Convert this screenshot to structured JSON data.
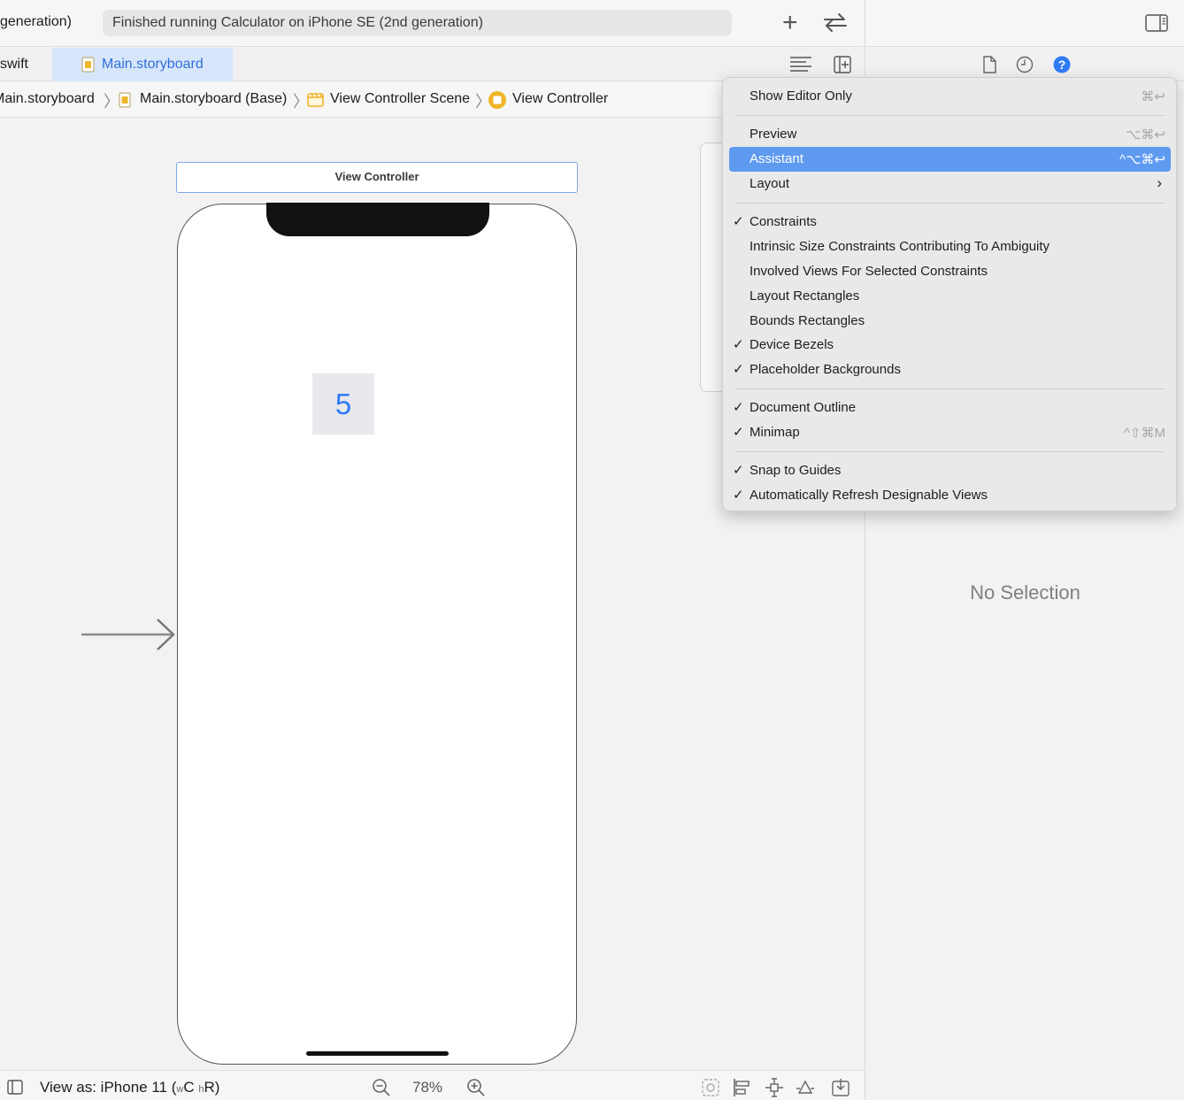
{
  "toolbar": {
    "scheme_text": "generation)",
    "activity_status": "Finished running Calculator on iPhone SE (2nd generation)"
  },
  "tabs": {
    "swift_tab": "swift",
    "storyboard_tab": "Main.storyboard"
  },
  "breadcrumb": {
    "items": [
      "Main.storyboard",
      "Main.storyboard (Base)",
      "View Controller Scene",
      "View Controller"
    ]
  },
  "canvas": {
    "scene_title": "View Controller",
    "result_label": "5"
  },
  "bottombar": {
    "view_as_prefix": "View as: iPhone 11 (",
    "w_small": "w",
    "w_value": "C ",
    "h_small": "h",
    "h_value": "R)",
    "zoom_level": "78%"
  },
  "inspector": {
    "empty_state": "No Selection"
  },
  "editor_menu": {
    "items": [
      {
        "label": "Show Editor Only",
        "shortcut": "⌘↩",
        "checked": false
      },
      {
        "label": "Preview",
        "shortcut": "⌥⌘↩",
        "checked": false
      },
      {
        "label": "Assistant",
        "shortcut": "^⌥⌘↩",
        "checked": false,
        "selected": true
      },
      {
        "label": "Layout",
        "shortcut": "",
        "checked": false,
        "submenu": true
      },
      {
        "label": "Constraints",
        "shortcut": "",
        "checked": true
      },
      {
        "label": "Intrinsic Size Constraints Contributing To Ambiguity",
        "shortcut": "",
        "checked": false
      },
      {
        "label": "Involved Views For Selected Constraints",
        "shortcut": "",
        "checked": false
      },
      {
        "label": "Layout Rectangles",
        "shortcut": "",
        "checked": false
      },
      {
        "label": "Bounds Rectangles",
        "shortcut": "",
        "checked": false
      },
      {
        "label": "Device Bezels",
        "shortcut": "",
        "checked": true
      },
      {
        "label": "Placeholder Backgrounds",
        "shortcut": "",
        "checked": true
      },
      {
        "label": "Document Outline",
        "shortcut": "",
        "checked": true
      },
      {
        "label": "Minimap",
        "shortcut": "^⇧⌘M",
        "checked": true
      },
      {
        "label": "Snap to Guides",
        "shortcut": "",
        "checked": true
      },
      {
        "label": "Automatically Refresh Designable Views",
        "shortcut": "",
        "checked": true
      }
    ],
    "check_glyph": "✓",
    "submenu_glyph": "›"
  },
  "colors": {
    "accent": "#2f7bf5",
    "menu_selection": "#5e9af0",
    "tab_selected_bg": "#d7e6fb",
    "storyboard_icon": "#f0b429"
  },
  "icons": [
    "add-icon",
    "swap-arrows-icon",
    "inspector-toggle-icon",
    "storyboard-file-icon",
    "scene-icon",
    "view-controller-icon",
    "lines-icon",
    "add-editor-icon",
    "file-inspector-icon",
    "history-inspector-icon",
    "help-inspector-icon",
    "outline-toggle-icon",
    "zoom-out-icon",
    "zoom-in-icon",
    "update-frames-icon",
    "align-icon",
    "add-constraints-icon",
    "resolve-issues-icon",
    "embed-icon"
  ]
}
